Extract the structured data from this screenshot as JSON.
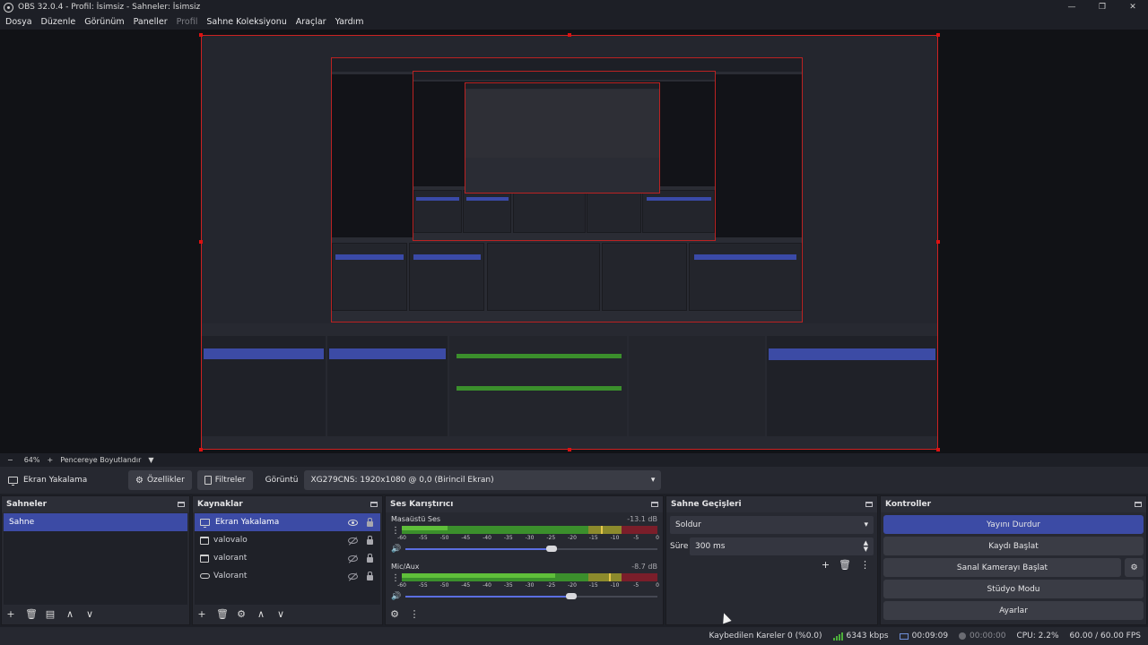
{
  "window": {
    "title": "OBS 32.0.4 - Profil: İsimsiz - Sahneler: İsimsiz",
    "buttons": [
      "—",
      "❐",
      "✕"
    ]
  },
  "menu": [
    {
      "label": "Dosya",
      "enabled": true
    },
    {
      "label": "Düzenle",
      "enabled": true
    },
    {
      "label": "Görünüm",
      "enabled": true
    },
    {
      "label": "Paneller",
      "enabled": true
    },
    {
      "label": "Profil",
      "enabled": false
    },
    {
      "label": "Sahne Koleksiyonu",
      "enabled": true
    },
    {
      "label": "Araçlar",
      "enabled": true
    },
    {
      "label": "Yardım",
      "enabled": true
    }
  ],
  "zoom": {
    "minus": "−",
    "level": "64%",
    "plus": "+",
    "fit_label": "Pencereye Boyutlandır",
    "arrow": "▼"
  },
  "source_bar": {
    "source_name": "Ekran Yakalama",
    "properties_label": "Özellikler",
    "filters_label": "Filtreler",
    "display_label": "Görüntü",
    "display_value": "XG279CNS: 1920x1080 @ 0,0 (Birincil Ekran)"
  },
  "scenes": {
    "title": "Sahneler",
    "items": [
      {
        "label": "Sahne",
        "selected": true
      }
    ],
    "footer": [
      "+",
      "🗑",
      "▤",
      "∧",
      "∨"
    ]
  },
  "sources": {
    "title": "Kaynaklar",
    "items": [
      {
        "label": "Ekran Yakalama",
        "icon": "monitor-icon",
        "visible": true,
        "selected": true
      },
      {
        "label": "valovalo",
        "icon": "browser-icon",
        "visible": false,
        "selected": false
      },
      {
        "label": "valorant",
        "icon": "browser-icon",
        "visible": false,
        "selected": false
      },
      {
        "label": "Valorant",
        "icon": "gamepad-icon",
        "visible": false,
        "selected": false
      }
    ],
    "footer": [
      "+",
      "🗑",
      "⚙",
      "∧",
      "∨"
    ]
  },
  "mixer": {
    "title": "Ses Karıştırıcı",
    "ticks": [
      "-60",
      "-55",
      "-50",
      "-45",
      "-40",
      "-35",
      "-30",
      "-25",
      "-20",
      "-15",
      "-10",
      "-5",
      "0"
    ],
    "channels": [
      {
        "name": "Masaüstü Ses",
        "db": "-13.1 dB",
        "level": 0.18,
        "peak": 0.78,
        "volume": 0.58
      },
      {
        "name": "Mic/Aux",
        "db": "-8.7 dB",
        "level": 0.6,
        "peak": 0.81,
        "volume": 0.66
      }
    ],
    "footer": [
      "⚙",
      "⋮"
    ]
  },
  "transitions": {
    "title": "Sahne Geçişleri",
    "type_value": "Soldur",
    "duration_label": "Süre",
    "duration_value": "300 ms",
    "footer": [
      "+",
      "🗑",
      "⋮"
    ]
  },
  "controls": {
    "title": "Kontroller",
    "buttons": [
      {
        "label": "Yayını Durdur",
        "active": true
      },
      {
        "label": "Kaydı Başlat",
        "active": false
      },
      {
        "label": "Sanal Kamerayı Başlat",
        "active": false
      },
      {
        "label": "Stüdyo Modu",
        "active": false
      },
      {
        "label": "Ayarlar",
        "active": false
      }
    ]
  },
  "status": {
    "dropped_frames": "Kaybedilen Kareler 0 (%0.0)",
    "bitrate": "6343 kbps",
    "stream_time": "00:09:09",
    "rec_time": "00:00:00",
    "cpu": "CPU: 2.2%",
    "fps": "60.00 / 60.00 FPS"
  },
  "colors": {
    "accent": "#3c4ba5",
    "background": "#1d1f26",
    "selection_border": "#cc2222"
  }
}
